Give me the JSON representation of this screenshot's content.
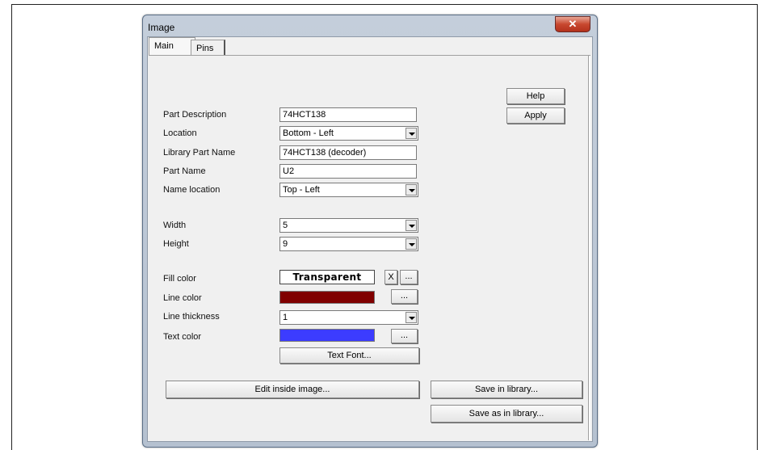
{
  "window": {
    "title": "Image"
  },
  "tabs": [
    {
      "label": "Main"
    },
    {
      "label": "Pins"
    }
  ],
  "buttons": {
    "help": "Help",
    "apply": "Apply",
    "text_font": "Text Font...",
    "edit_inside": "Edit inside image...",
    "save_library": "Save in library...",
    "save_as_library": "Save as in library...",
    "clear_fill": "X",
    "ellipsis": "..."
  },
  "fields": {
    "part_description": {
      "label": "Part Description",
      "value": "74HCT138"
    },
    "location": {
      "label": "Location",
      "value": "Bottom - Left"
    },
    "library_part_name": {
      "label": "Library Part Name",
      "value": "74HCT138 (decoder)"
    },
    "part_name": {
      "label": "Part Name",
      "value": "U2"
    },
    "name_location": {
      "label": "Name location",
      "value": "Top - Left"
    },
    "width": {
      "label": "Width",
      "value": "5"
    },
    "height": {
      "label": "Height",
      "value": "9"
    },
    "fill_color": {
      "label": "Fill color",
      "value": "Transparent"
    },
    "line_color": {
      "label": "Line color",
      "color": "#800000"
    },
    "line_thickness": {
      "label": "Line thickness",
      "value": "1"
    },
    "text_color": {
      "label": "Text color",
      "color": "#3c3cff"
    }
  }
}
